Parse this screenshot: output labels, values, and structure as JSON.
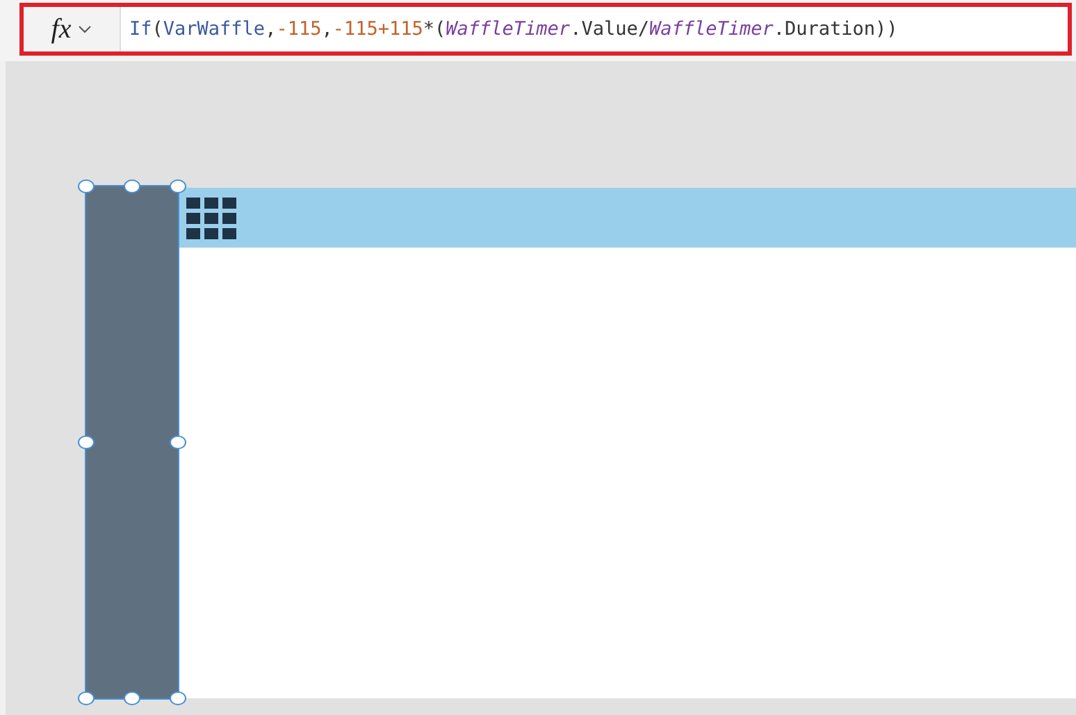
{
  "formula_bar": {
    "fx_label": "fx",
    "tokens": [
      {
        "text": "If",
        "kind": "function"
      },
      {
        "text": "(",
        "kind": "punct"
      },
      {
        "text": "VarWaffle",
        "kind": "variable"
      },
      {
        "text": ",",
        "kind": "punct"
      },
      {
        "text": "-115",
        "kind": "number"
      },
      {
        "text": ",",
        "kind": "punct"
      },
      {
        "text": "-115+115",
        "kind": "number"
      },
      {
        "text": "*(",
        "kind": "punct"
      },
      {
        "text": "WaffleTimer",
        "kind": "control"
      },
      {
        "text": ".Value/",
        "kind": "punct"
      },
      {
        "text": "WaffleTimer",
        "kind": "control"
      },
      {
        "text": ".Duration))",
        "kind": "punct"
      }
    ],
    "highlighted": true
  },
  "canvas": {
    "selected_rectangle": {
      "selected": true
    }
  }
}
